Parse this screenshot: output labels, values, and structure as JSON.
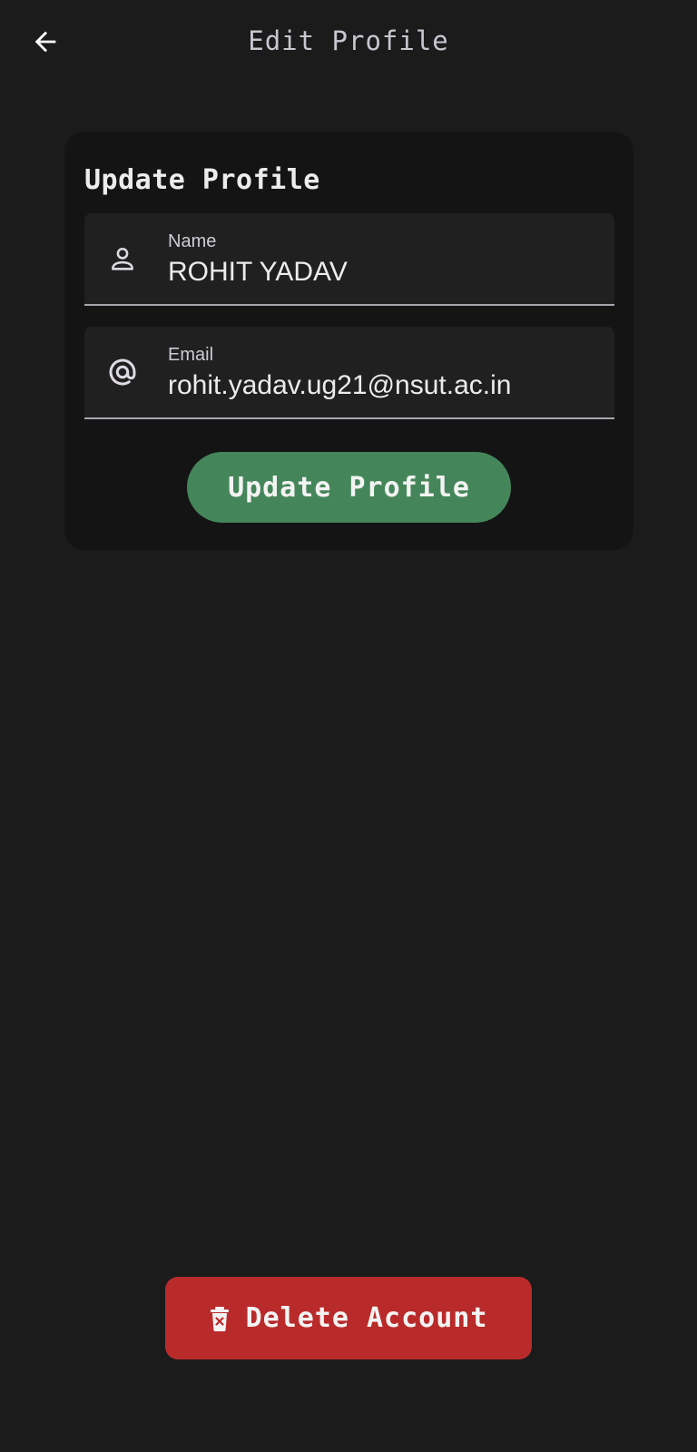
{
  "appbar": {
    "back_icon": "arrow-left-icon",
    "title": "Edit Profile"
  },
  "card": {
    "title": "Update Profile",
    "fields": {
      "name": {
        "icon": "person-icon",
        "label": "Name",
        "value": "ROHIT YADAV"
      },
      "email": {
        "icon": "at-icon",
        "label": "Email",
        "value": "rohit.yadav.ug21@nsut.ac.in"
      }
    },
    "update_button_label": "Update Profile"
  },
  "delete": {
    "icon": "trash-icon",
    "label": "Delete Account"
  },
  "colors": {
    "background": "#1b1b1b",
    "card": "#141414",
    "field": "#202020",
    "update_button": "#44865a",
    "delete_button": "#b92b2b"
  }
}
